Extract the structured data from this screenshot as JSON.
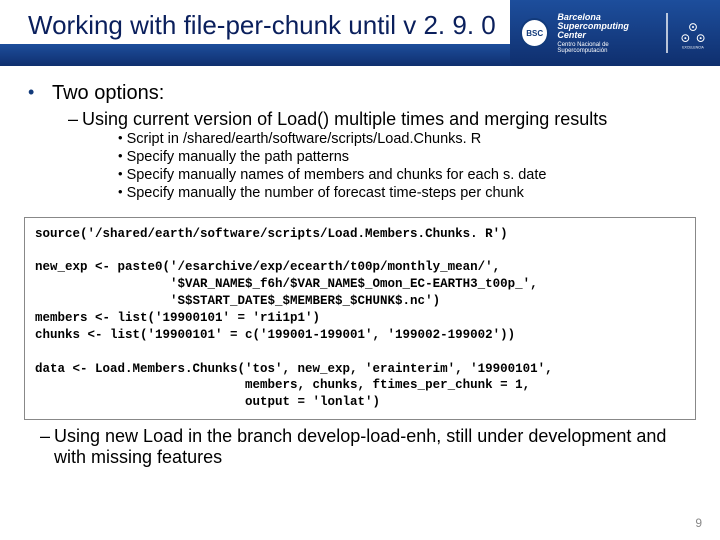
{
  "header": {
    "title": "Working with file-per-chunk until v 2. 9. 0",
    "bsc_abbrev": "BSC",
    "bsc_line1": "Barcelona",
    "bsc_line2": "Supercomputing",
    "bsc_line3": "Center",
    "bsc_line4": "Centro Nacional de Supercomputación"
  },
  "bullets": {
    "l1": "Two options:",
    "l2a": "Using current version of Load() multiple times and merging results",
    "l3a": "Script in /shared/earth/software/scripts/Load.Chunks. R",
    "l3b": "Specify manually the path patterns",
    "l3c": "Specify manually names of members and chunks for each s. date",
    "l3d": "Specify manually the number of forecast time-steps per chunk",
    "l2b": "Using new Load in the branch develop-load-enh, still under development and with missing features"
  },
  "code": "source('/shared/earth/software/scripts/Load.Members.Chunks. R')\n\nnew_exp <- paste0('/esarchive/exp/ecearth/t00p/monthly_mean/',\n                  '$VAR_NAME$_f6h/$VAR_NAME$_Omon_EC-EARTH3_t00p_',\n                  'S$START_DATE$_$MEMBER$_$CHUNK$.nc')\nmembers <- list('19900101' = 'r1i1p1')\nchunks <- list('19900101' = c('199001-199001', '199002-199002'))\n\ndata <- Load.Members.Chunks('tos', new_exp, 'erainterim', '19900101',\n                            members, chunks, ftimes_per_chunk = 1,\n                            output = 'lonlat')",
  "page_number": "9"
}
